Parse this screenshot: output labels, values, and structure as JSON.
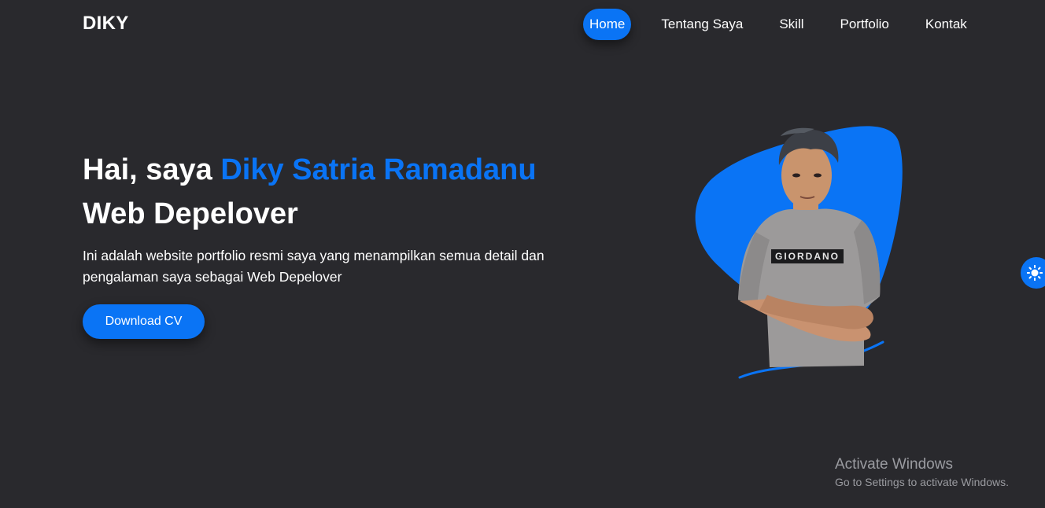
{
  "navbar": {
    "brand": "DIKY",
    "links": [
      {
        "label": "Home",
        "active": true
      },
      {
        "label": "Tentang Saya",
        "active": false
      },
      {
        "label": "Skill",
        "active": false
      },
      {
        "label": "Portfolio",
        "active": false
      },
      {
        "label": "Kontak",
        "active": false
      }
    ]
  },
  "hero": {
    "greeting": "Hai, saya ",
    "name": "Diky Satria Ramadanu",
    "role": "Web Depelover",
    "description": "Ini adalah website portfolio resmi saya yang menampilkan semua detail dan pengalaman saya sebagai Web Depelover",
    "cv_button": "Download CV",
    "shirt_text": "GIORDANO"
  },
  "theme_toggle": {
    "icon": "sun-icon"
  },
  "watermark": {
    "title": "Activate Windows",
    "subtitle": "Go to Settings to activate Windows."
  },
  "colors": {
    "background": "#29292d",
    "accent": "#0a74f5",
    "text": "#ffffff",
    "watermark": "#9a9ba0"
  }
}
